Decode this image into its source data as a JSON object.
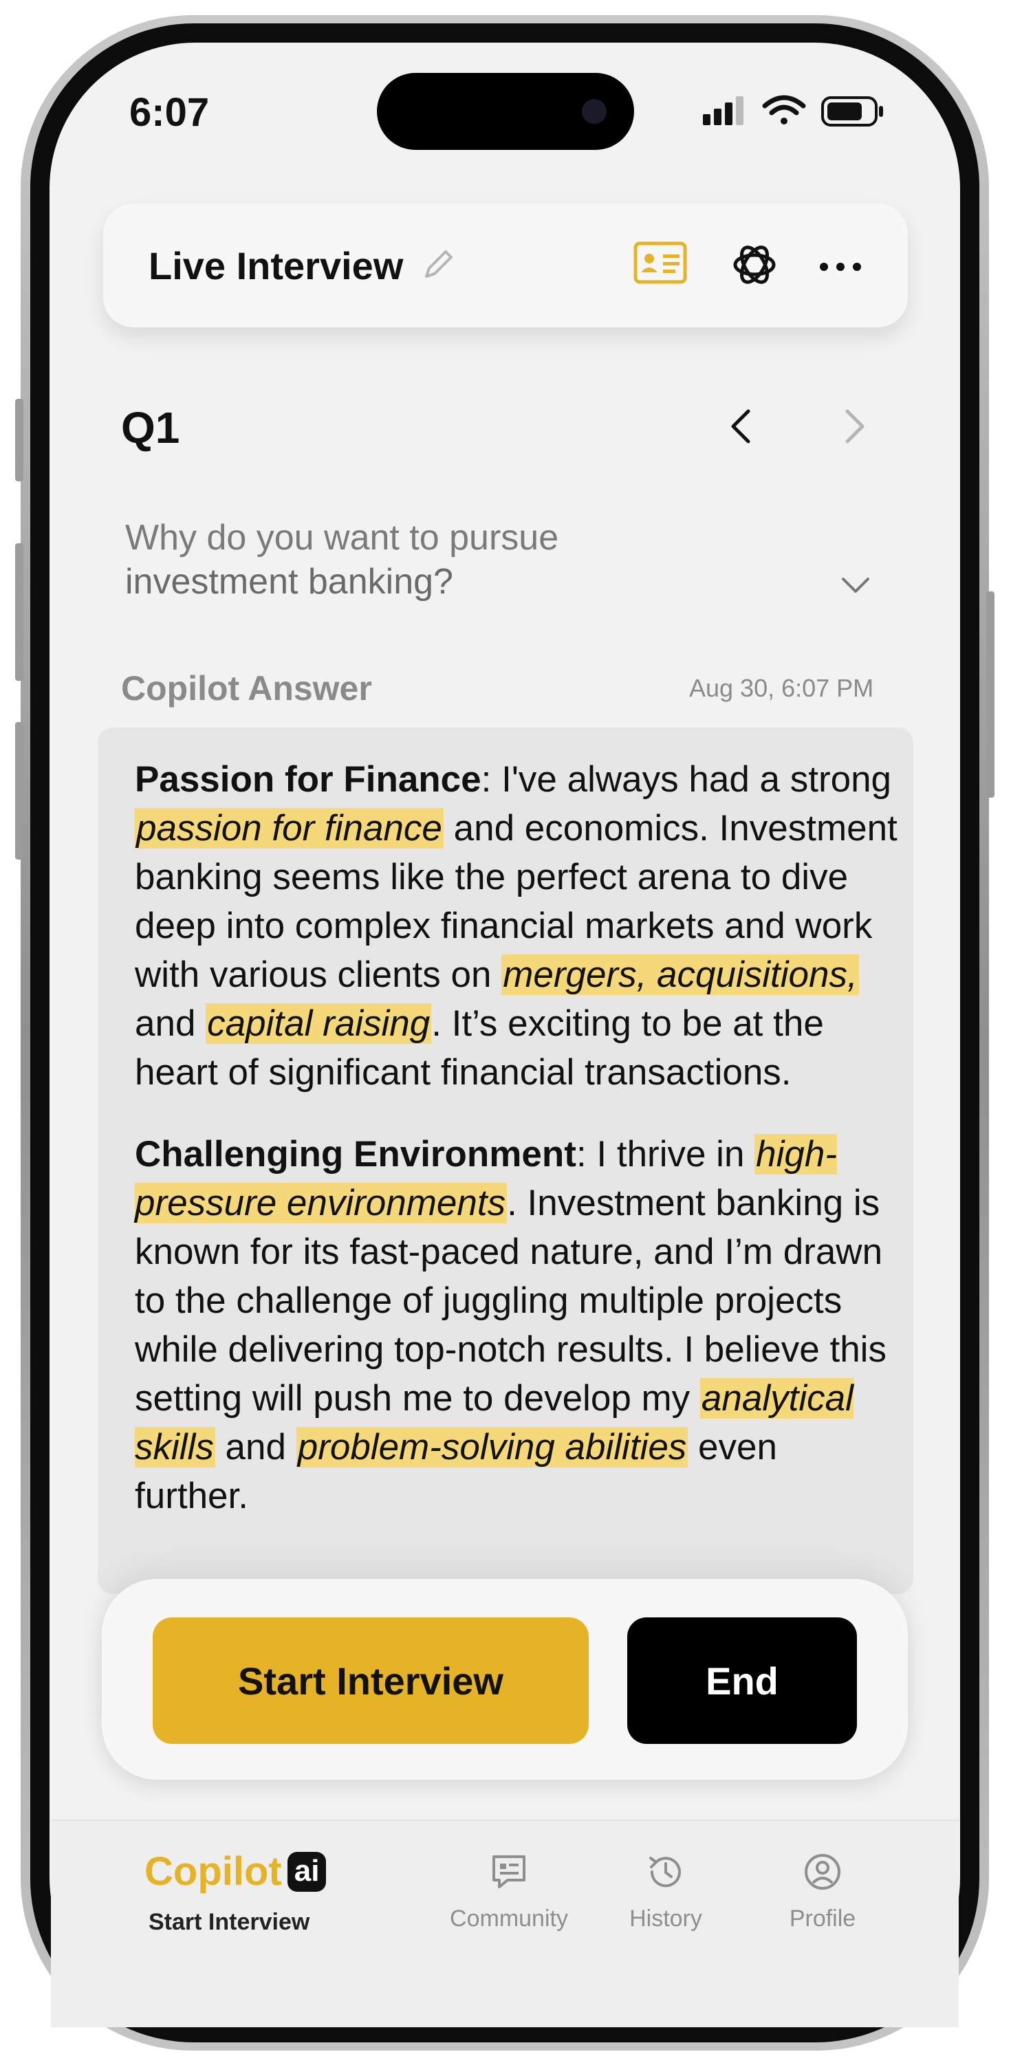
{
  "status_bar": {
    "time": "6:07"
  },
  "header": {
    "title": "Live Interview"
  },
  "question": {
    "label": "Q1",
    "text_line1": "Why do you want to pursue",
    "text_line2": "investment banking?"
  },
  "answer": {
    "label": "Copilot Answer",
    "date": "Aug 30, 6:07 PM",
    "p1": {
      "heading": "Passion for Finance",
      "t1": ": I've always had a strong ",
      "h1": "passion for finance",
      "t2": " and economics. Investment banking seems like the perfect arena to dive deep into complex financial markets and work with various clients on ",
      "h2": "mergers, acquisitions,",
      "t3": " and ",
      "h3": "capital raising",
      "t4": ". It’s exciting to be at the heart of significant financial transactions."
    },
    "p2": {
      "heading": "Challenging Environment",
      "t1": ": I thrive in ",
      "h1": "high-pressure environments",
      "t2": ". Investment banking is known for its fast-paced nature, and I’m drawn to the challenge of juggling multiple projects while delivering top-notch results. I believe this setting will push me to develop my ",
      "h2": "analytical skills",
      "t3": " and ",
      "h3": "problem-solving abilities",
      "t4": " even further."
    }
  },
  "actions": {
    "start_label": "Start Interview",
    "end_label": "End"
  },
  "tab_bar": {
    "brand": "Copilot",
    "brand_badge": "ai",
    "copilot_label": "Start Interview",
    "community": "Community",
    "history": "History",
    "profile": "Profile"
  },
  "colors": {
    "accent": "#e5b325",
    "highlight": "#f5d879",
    "background": "#f2f2f2"
  }
}
